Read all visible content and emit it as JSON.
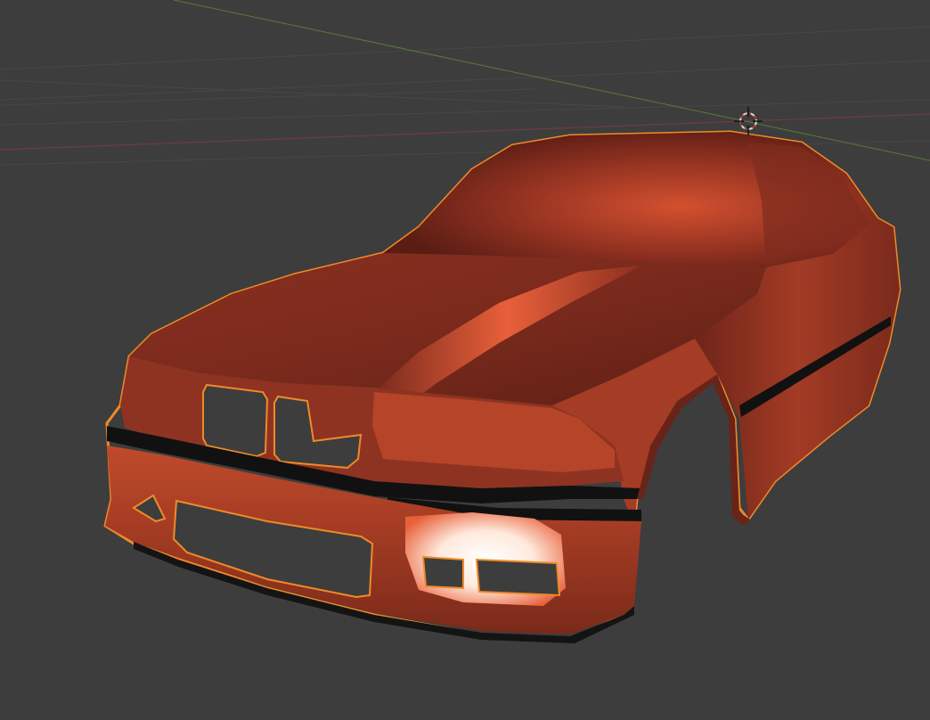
{
  "viewport": {
    "background_color": "#3d3d3d",
    "grid_line_color": "#4a4a4a",
    "x_axis_color": "#8a3c46",
    "y_axis_color": "#5a7a3a"
  },
  "scene": {
    "object": {
      "label": "car-body",
      "selected": true,
      "base_color": "#b5432a",
      "outline_color": "#f08a28",
      "highlight_color": "#ffffff"
    },
    "cursor_3d": {
      "icon": "crosshair-cursor-icon",
      "color_a": "#d9d9d9",
      "color_b": "#c0392b"
    }
  }
}
